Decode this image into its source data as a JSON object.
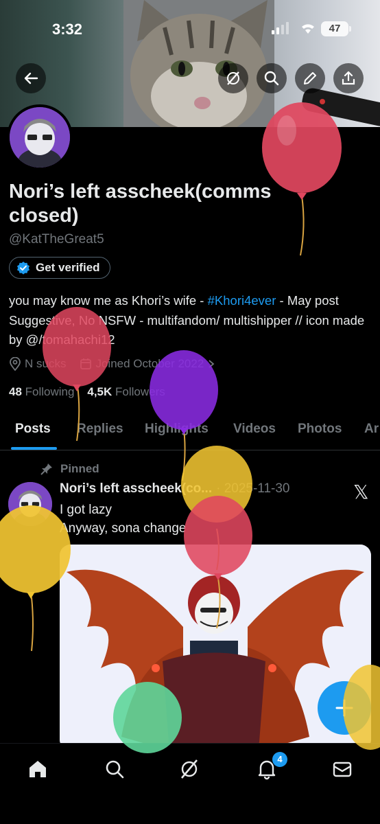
{
  "status_bar": {
    "time": "3:32",
    "battery": "47"
  },
  "profile": {
    "display_name": "Nori’s left asscheek(comms closed)",
    "handle": "@KatTheGreat5",
    "verify_label": "Get verified",
    "bio_part1": "you may know me as Khori’s wife - ",
    "bio_hashtag": "#Khori4ever",
    "bio_part2": " - May post Suggestive, No NSFW - multifandom/ multishipper // icon made by @/tomahachi12",
    "location": "N sucks",
    "joined": "Joined October 2022",
    "following_count": "48",
    "following_label": "Following",
    "followers_count": "4,5K",
    "followers_label": "Followers"
  },
  "tabs": [
    "Posts",
    "Replies",
    "Highlights",
    "Videos",
    "Photos",
    "Ar"
  ],
  "post": {
    "pinned_label": "Pinned",
    "author": "Nori’s left asscheek(co...",
    "date": "· 2025-11-30",
    "line1": "I got lazy",
    "line2": "Anyway, sona change"
  },
  "notifications_badge": "4",
  "colors": {
    "accent": "#1d9bf0",
    "background": "#000000",
    "muted": "#71767b"
  }
}
